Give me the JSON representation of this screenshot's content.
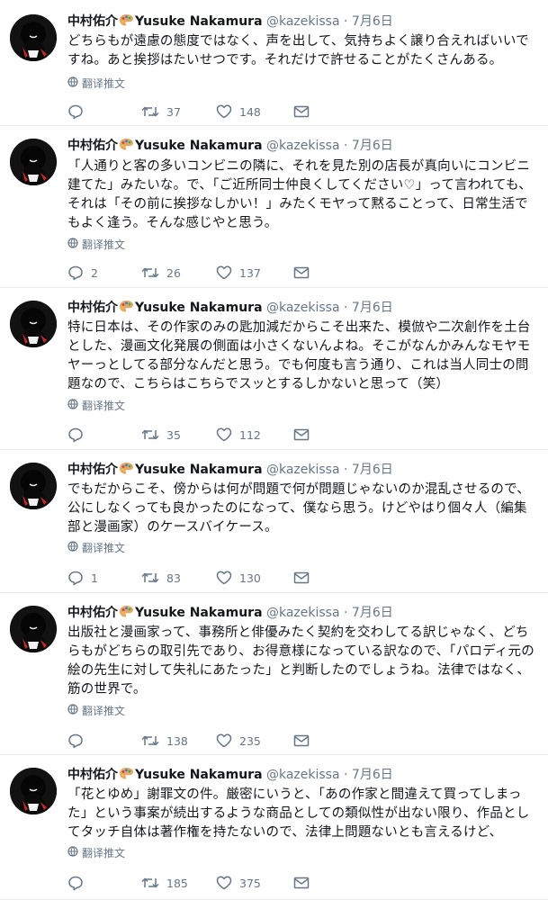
{
  "user": {
    "display_name": "中村佑介",
    "latin_name": "Yusuke Nakamura",
    "handle": "@kazekissa",
    "separator": "·"
  },
  "translate_label": "翻译推文",
  "colors": {
    "text": "#14171a",
    "muted": "#657786",
    "divider": "#e6ecf0"
  },
  "tweets": [
    {
      "date": "7月6日",
      "text": "どちらもが遠慮の態度ではなく、声を出して、気持ちよく譲り合えればいいですね。あと挨拶はたいせつです。それだけで許せることがたくさんある。",
      "reply_count": "",
      "retweet_count": "37",
      "like_count": "148"
    },
    {
      "date": "7月6日",
      "text": "「人通りと客の多いコンビニの隣に、それを見た別の店長が真向いにコンビニ建てた」みたいな。で、「ご近所同士仲良くしてください♡」って言われても、それは「その前に挨拶なしかい！」みたくモヤって黙ることって、日常生活でもよく逢う。そんな感じやと思う。",
      "reply_count": "2",
      "retweet_count": "26",
      "like_count": "137"
    },
    {
      "date": "7月6日",
      "text": "特に日本は、その作家のみの匙加減だからこそ出来た、模倣や二次創作を土台とした、漫画文化発展の側面は小さくないんよね。そこがなんかみんなモヤモヤーっとしてる部分なんだと思う。でも何度も言う通り、これは当人同士の問題なので、こちらはこちらでスッとするしかないと思って（笑）",
      "reply_count": "",
      "retweet_count": "35",
      "like_count": "112"
    },
    {
      "date": "7月6日",
      "text": "でもだからこそ、傍からは何が問題で何が問題じゃないのか混乱させるので、公にしなくっても良かったのになって、僕なら思う。けどやはり個々人（編集部と漫画家）のケースバイケース。",
      "reply_count": "1",
      "retweet_count": "83",
      "like_count": "130"
    },
    {
      "date": "7月6日",
      "text": "出版社と漫画家って、事務所と俳優みたく契約を交わしてる訳じゃなく、どちらもがどちらの取引先であり、お得意様になっている訳なので、「パロディ元の絵の先生に対して失礼にあたった」と判断したのでしょうね。法律ではなく、筋の世界で。",
      "reply_count": "",
      "retweet_count": "138",
      "like_count": "235"
    },
    {
      "date": "7月6日",
      "text": "「花とゆめ」謝罪文の件。厳密にいうと、「あの作家と間違えて買ってしまった」という事案が続出するような商品としての類似性が出ない限り、作品としてタッチ自体は著作権を持たないので、法律上問題ないとも言えるけど、",
      "reply_count": "",
      "retweet_count": "185",
      "like_count": "375"
    }
  ]
}
